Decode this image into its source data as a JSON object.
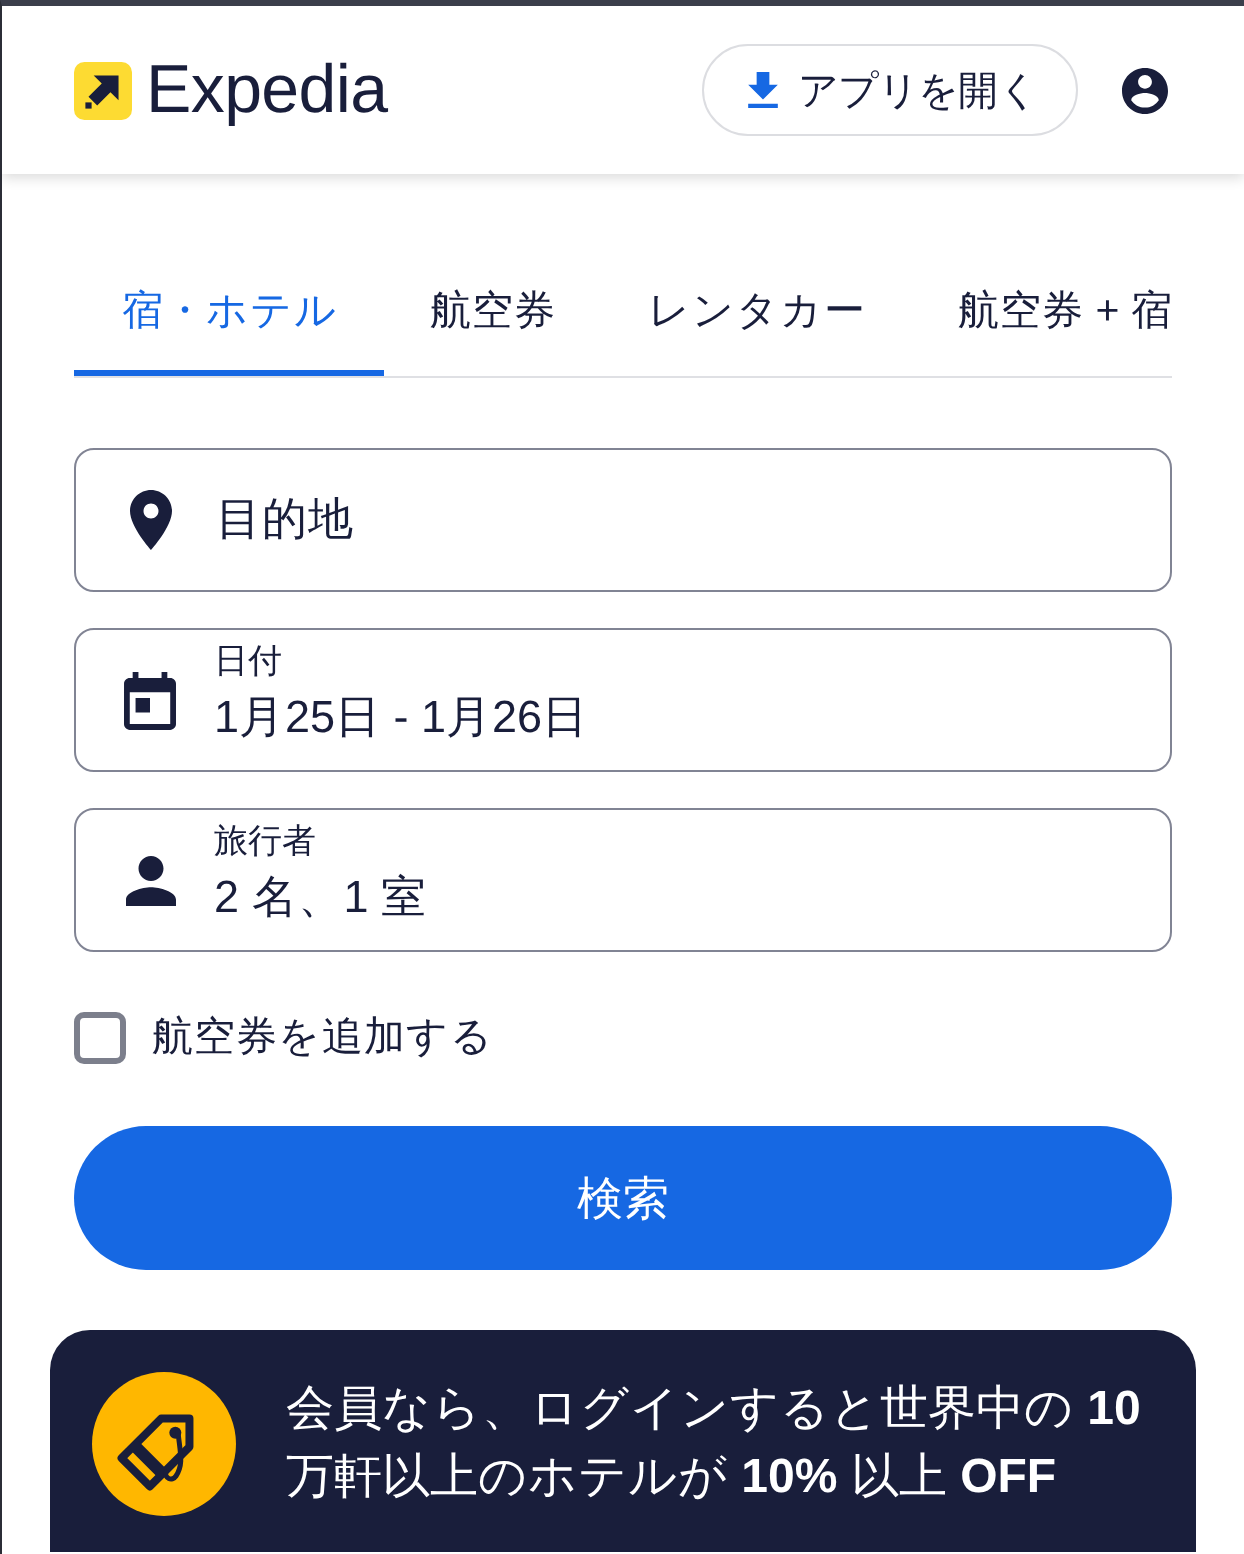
{
  "header": {
    "logo": {
      "text": "Expedia"
    },
    "open_app_button": {
      "label": "アプリを開く"
    }
  },
  "tabs": [
    {
      "label": "宿・ホテル",
      "selected": true
    },
    {
      "label": "航空券",
      "selected": false
    },
    {
      "label": "レンタカー",
      "selected": false
    },
    {
      "label": "航空券 + 宿",
      "selected": false
    }
  ],
  "fields": [
    {
      "kind": "destination",
      "placeholder": "目的地"
    },
    {
      "kind": "dates",
      "label": "日付",
      "value": "1月25日 - 1月26日"
    },
    {
      "kind": "travelers",
      "label": "旅行者",
      "value": "2 名、1 室"
    }
  ],
  "add_flight": {
    "label": "航空券を追加する",
    "checked": false
  },
  "search_button": {
    "label": "検索"
  },
  "promo": {
    "text": "会員なら、ログインすると世界中の **10** 万軒以上のホテルが **10%** 以上 **OFF**"
  }
}
